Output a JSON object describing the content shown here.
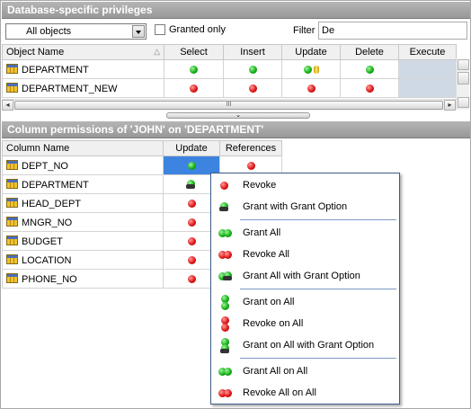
{
  "top_panel": {
    "title": "Database-specific privileges",
    "object_filter": "All objects",
    "granted_only_label": "Granted only",
    "filter_label": "Filter",
    "filter_value": "De",
    "columns": [
      "Object Name",
      "Select",
      "Insert",
      "Update",
      "Delete",
      "Execute"
    ],
    "rows": [
      {
        "name": "DEPARTMENT",
        "select": "green",
        "insert": "green",
        "update": "green+cylinder",
        "delete": "green",
        "execute": ""
      },
      {
        "name": "DEPARTMENT_NEW",
        "select": "red",
        "insert": "red",
        "update": "red",
        "delete": "red",
        "execute": ""
      }
    ],
    "hscroll_thumb": "III",
    "splitter_glyph": "⌄"
  },
  "bottom_panel": {
    "title": "Column permissions of 'JOHN' on 'DEPARTMENT'",
    "columns": [
      "Column Name",
      "Update",
      "References"
    ],
    "rows": [
      {
        "name": "DEPT_NO",
        "update": "green-selected",
        "references": "red"
      },
      {
        "name": "DEPARTMENT",
        "update": "grant-option",
        "references": ""
      },
      {
        "name": "HEAD_DEPT",
        "update": "red",
        "references": ""
      },
      {
        "name": "MNGR_NO",
        "update": "red",
        "references": ""
      },
      {
        "name": "BUDGET",
        "update": "red",
        "references": ""
      },
      {
        "name": "LOCATION",
        "update": "red",
        "references": ""
      },
      {
        "name": "PHONE_NO",
        "update": "red",
        "references": ""
      }
    ]
  },
  "context_menu": {
    "items": [
      {
        "label": "Revoke",
        "icon": "red-dot-icon"
      },
      {
        "label": "Grant with Grant Option",
        "icon": "grant-option-icon"
      },
      {
        "label": "Grant All",
        "icon": "green-double-dot-icon"
      },
      {
        "label": "Revoke All",
        "icon": "red-double-dot-icon"
      },
      {
        "label": "Grant All with Grant Option",
        "icon": "grant-all-option-icon"
      },
      {
        "label": "Grant on All",
        "icon": "green-stack-icon"
      },
      {
        "label": "Revoke on All",
        "icon": "red-stack-icon"
      },
      {
        "label": "Grant on All with Grant Option",
        "icon": "grant-stack-option-icon"
      },
      {
        "label": "Grant All on All",
        "icon": "green-double-dot-icon"
      },
      {
        "label": "Revoke All on All",
        "icon": "red-double-dot-icon"
      }
    ]
  },
  "colors": {
    "grant": "#16b116",
    "revoke": "#e01818",
    "header": "#a8a8a8",
    "selection": "#3d84e0",
    "menu_border": "#3e5c87"
  }
}
